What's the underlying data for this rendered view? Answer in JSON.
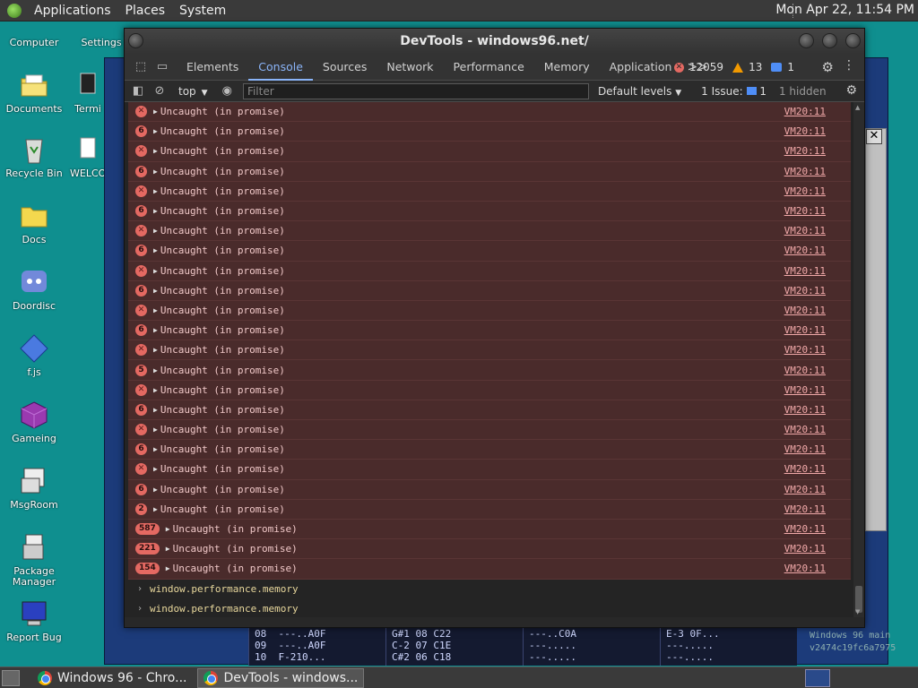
{
  "top_panel": {
    "menus": [
      "Applications",
      "Places",
      "System"
    ],
    "clock": "Mon Apr 22, 11:54 PM"
  },
  "desktop_icons": [
    {
      "label": "Computer"
    },
    {
      "label": "Settings"
    },
    {
      "label": "Documents"
    },
    {
      "label": "Termi"
    },
    {
      "label": "Recycle Bin"
    },
    {
      "label": "WELCO"
    },
    {
      "label": "Docs"
    },
    {
      "label": "Doordisc"
    },
    {
      "label": "f.js"
    },
    {
      "label": "Gameing"
    },
    {
      "label": "MsgRoom"
    },
    {
      "label": "Package Manager"
    },
    {
      "label": "Report Bug"
    }
  ],
  "devtools": {
    "title": "DevTools - windows96.net/",
    "tabs": [
      "Elements",
      "Console",
      "Sources",
      "Network",
      "Performance",
      "Memory",
      "Application"
    ],
    "active_tab": "Console",
    "more": ">>",
    "error_count": "12059",
    "warning_count": "13",
    "info_count": "1",
    "filter": {
      "context": "top",
      "placeholder": "Filter",
      "levels": "Default levels",
      "issue_label": "1 Issue:",
      "issue_count": "1",
      "hidden": "1 hidden"
    },
    "rows": [
      {
        "badge": "",
        "msg": "Uncaught (in promise)",
        "src": "VM20:11"
      },
      {
        "badge": "6",
        "msg": "Uncaught (in promise)",
        "src": "VM20:11"
      },
      {
        "badge": "",
        "msg": "Uncaught (in promise)",
        "src": "VM20:11"
      },
      {
        "badge": "6",
        "msg": "Uncaught (in promise)",
        "src": "VM20:11"
      },
      {
        "badge": "",
        "msg": "Uncaught (in promise)",
        "src": "VM20:11"
      },
      {
        "badge": "6",
        "msg": "Uncaught (in promise)",
        "src": "VM20:11"
      },
      {
        "badge": "",
        "msg": "Uncaught (in promise)",
        "src": "VM20:11"
      },
      {
        "badge": "6",
        "msg": "Uncaught (in promise)",
        "src": "VM20:11"
      },
      {
        "badge": "",
        "msg": "Uncaught (in promise)",
        "src": "VM20:11"
      },
      {
        "badge": "6",
        "msg": "Uncaught (in promise)",
        "src": "VM20:11"
      },
      {
        "badge": "",
        "msg": "Uncaught (in promise)",
        "src": "VM20:11"
      },
      {
        "badge": "6",
        "msg": "Uncaught (in promise)",
        "src": "VM20:11"
      },
      {
        "badge": "",
        "msg": "Uncaught (in promise)",
        "src": "VM20:11"
      },
      {
        "badge": "5",
        "msg": "Uncaught (in promise)",
        "src": "VM20:11"
      },
      {
        "badge": "",
        "msg": "Uncaught (in promise)",
        "src": "VM20:11"
      },
      {
        "badge": "6",
        "msg": "Uncaught (in promise)",
        "src": "VM20:11"
      },
      {
        "badge": "",
        "msg": "Uncaught (in promise)",
        "src": "VM20:11"
      },
      {
        "badge": "6",
        "msg": "Uncaught (in promise)",
        "src": "VM20:11"
      },
      {
        "badge": "",
        "msg": "Uncaught (in promise)",
        "src": "VM20:11"
      },
      {
        "badge": "6",
        "msg": "Uncaught (in promise)",
        "src": "VM20:11"
      },
      {
        "badge": "2",
        "msg": "Uncaught (in promise)",
        "src": "VM20:11"
      },
      {
        "badge": "587",
        "msg": "Uncaught (in promise)",
        "src": "VM20:11"
      },
      {
        "badge": "221",
        "msg": "Uncaught (in promise)",
        "src": "VM20:11"
      },
      {
        "badge": "154",
        "msg": "Uncaught (in promise)",
        "src": "VM20:11"
      }
    ],
    "prompts": [
      "window.performance.memory",
      "window.performance.memory"
    ]
  },
  "bg_window": {
    "tracker_cols": [
      "08  ---..A0F\n09  ---..A0F\n10  F-210...",
      "G#1 08 C22\nC-2 07 C1E\nC#2 06 C18",
      "---..C0A\n---.....\n---.....",
      "E-3 0F...\n---.....\n---....."
    ],
    "side_text": "Windows 96 main\nv2474c19fc6a7975"
  },
  "taskbar": {
    "tasks": [
      "Windows 96 - Chro...",
      "DevTools - windows..."
    ]
  },
  "colors": {
    "desktop": "#0f8f8f",
    "error_row": "#4a2b2b",
    "error_badge": "#e46962",
    "accent": "#8ab4f8"
  }
}
